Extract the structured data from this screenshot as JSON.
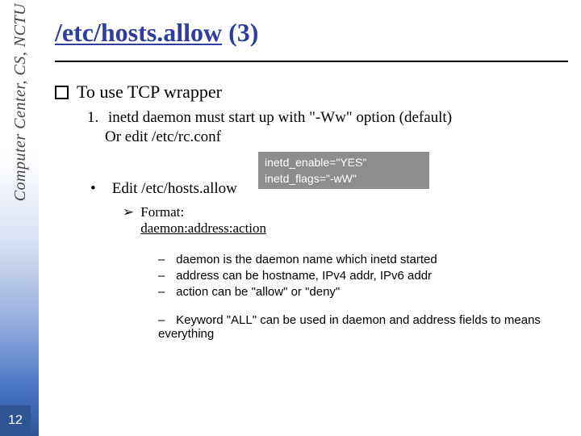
{
  "sidebar": {
    "text": "Computer Center, CS, NCTU",
    "page_number": "12"
  },
  "title": {
    "part1": "/etc/hosts.",
    "part2": "allow",
    "part3": " (3)"
  },
  "bullets": {
    "l1": "To use TCP wrapper",
    "l2_num": "1.",
    "l2_text": "inetd daemon must start up with \"-Ww\" option (default)",
    "l2b": "Or edit /etc/rc.conf",
    "code_line1": "inetd_enable=\"YES\"",
    "code_line2": "inetd_flags=\"-wW\"",
    "l2c_bullet": "•",
    "l2c_text": "Edit /etc/hosts.allow",
    "l3_tri": "➢",
    "l3_text1": "Format:",
    "l3_text2": "daemon:address:action",
    "dash": "–",
    "l4_1": "daemon is the daemon name which inetd started",
    "l4_2": "address can be hostname, IPv4 addr, IPv6 addr",
    "l4_3": "action can be \"allow\" or \"deny\"",
    "l4_4": "Keyword \"ALL\" can be used in daemon and address fields to means everything"
  }
}
